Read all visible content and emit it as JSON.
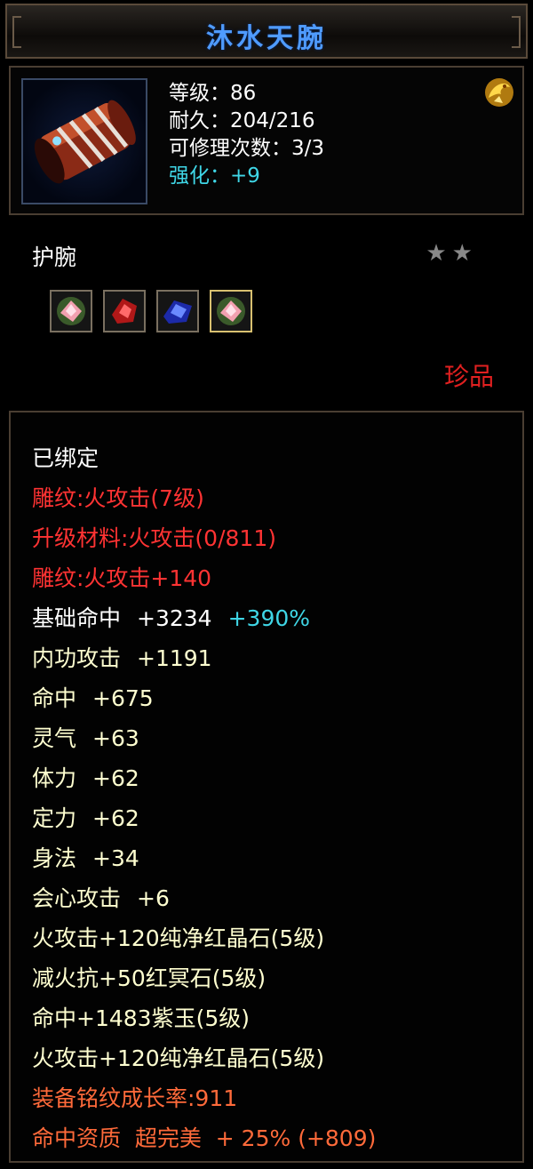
{
  "item": {
    "name": "沐水天腕",
    "type": "护腕",
    "quality": "珍品",
    "stars": "★★"
  },
  "header": {
    "level": "等级：86",
    "durability": "耐久：204/216",
    "repair": "可修理次数：3/3",
    "enhance": "强化：+9"
  },
  "gems": [
    "pink-crystal",
    "red-crystal",
    "blue-crystal",
    "pink-crystal"
  ],
  "attrs": {
    "bound": "已绑定",
    "engrave1": "雕纹:火攻击(7级)",
    "upgrade": "升级材料:火攻击(0/811)",
    "engrave2": "雕纹:火攻击+140",
    "base_hit_label": "基础命中",
    "base_hit_value": "+3234",
    "base_hit_pct": "+390%",
    "inner_atk_label": "内功攻击",
    "inner_atk_value": "+1191",
    "hit_label": "命中",
    "hit_value": "+675",
    "spirit_label": "灵气",
    "spirit_value": "+63",
    "stamina_label": "体力",
    "stamina_value": "+62",
    "focus_label": "定力",
    "focus_value": "+62",
    "agility_label": "身法",
    "agility_value": "+34",
    "crit_label": "会心攻击",
    "crit_value": "+6",
    "gem_line1": "火攻击+120纯净红晶石(5级)",
    "gem_line2": "减火抗+50红冥石(5级)",
    "gem_line3": "命中+1483紫玉(5级)",
    "gem_line4": "火攻击+120纯净红晶石(5级)",
    "growth": "装备铭纹成长率:911",
    "aptitude": "命中资质  超完美  + 25% (+809)"
  }
}
